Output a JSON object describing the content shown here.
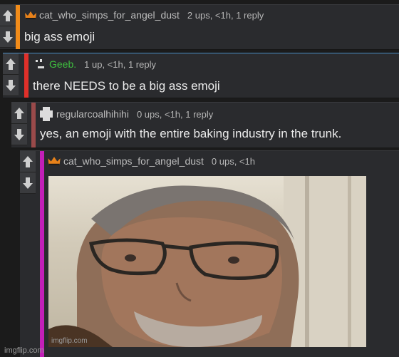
{
  "comments": [
    {
      "username": "cat_who_simps_for_angel_dust",
      "stats": "2 ups, <1h, 1 reply",
      "text": "big ass emoji",
      "avatar_icon": "crown-icon",
      "accent": "#f28c1a"
    },
    {
      "username": "Geeb.",
      "stats": "1 up, <1h, 1 reply",
      "text": "there NEEDS to be a big ass emoji",
      "avatar_icon": "pixel-face-icon",
      "accent": "#e0302a",
      "username_color": "#3fbf3f"
    },
    {
      "username": "regularcoalhihihi",
      "stats": "0 ups, <1h, 1 reply",
      "text": "yes, an emoji with the entire baking industry in the trunk.",
      "avatar_icon": "blocky-avatar-icon",
      "accent": "#9a4a4a"
    },
    {
      "username": "cat_who_simps_for_angel_dust",
      "stats": "0 ups, <1h",
      "avatar_icon": "crown-icon",
      "accent": "#c21fb8",
      "image_watermark": "imgflip.com"
    }
  ],
  "page_watermark": "imgflip.com"
}
